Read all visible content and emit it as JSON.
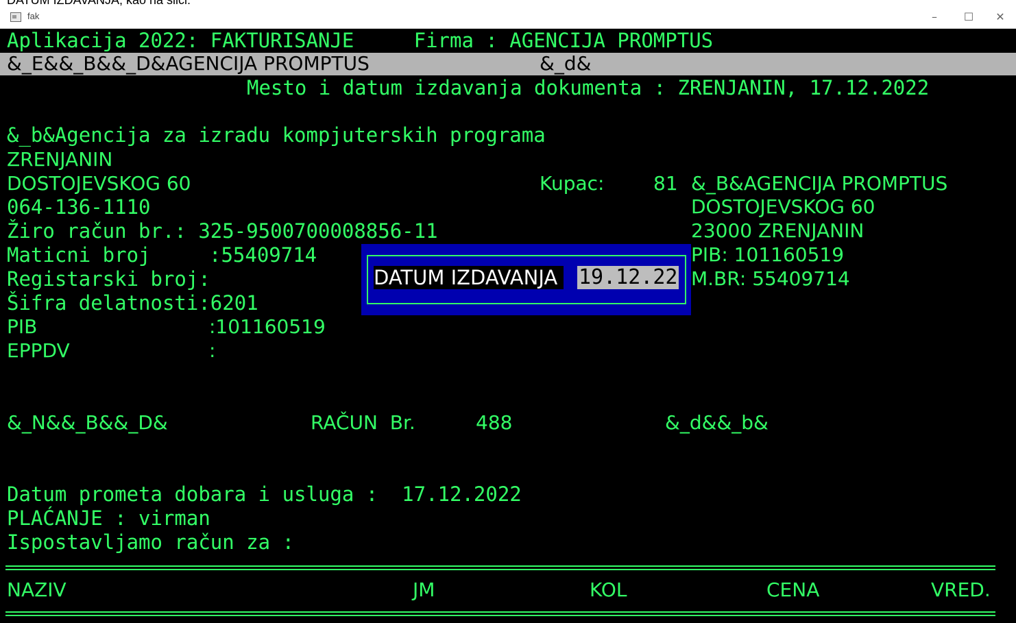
{
  "window": {
    "title": "fak",
    "caption_above": "DATUM IZDAVANJA, kao na slici:",
    "minimize": "–",
    "maximize": "☐",
    "close": "✕"
  },
  "header": {
    "app_line": "Aplikacija 2022: FAKTURISANJE     Firma : AGENCIJA PROMPTUS",
    "bar_left": "&_E&&_B&&_D&AGENCIJA PROMPTUS",
    "bar_right": "&_d&",
    "place_date": "Mesto i datum izdavanja dokumenta : ZRENJANIN, 17.12.2022"
  },
  "issuer": {
    "line1": "&_b&Agencija za izradu kompjuterskih programa",
    "city": "ZRENJANIN",
    "address": "DOSTOJEVSKOG 60",
    "phone": "064-136-1110",
    "account": "Žiro račun br.: 325-9500700008856-11",
    "maticni_label": "Maticni broj    ",
    "maticni_value": ":55409714",
    "registarski": "Registarski broj:",
    "sifra": "Šifra delatnosti:6201",
    "pib_label": "PIB",
    "pib_value": ":101160519",
    "eppdv_label": "EPPDV",
    "eppdv_value": ":"
  },
  "buyer": {
    "label": "Kupac:",
    "id": "81",
    "name": "&_B&AGENCIJA PROMPTUS",
    "address": "DOSTOJEVSKOG 60",
    "city": "23000 ZRENJANIN",
    "pib": "PIB: 101160519",
    "mbr": "M.BR: 55409714"
  },
  "dialog": {
    "label": "DATUM IZDAVANJA ",
    "value": "19.12.22"
  },
  "invoice": {
    "codes_left": "&_N&&_B&&_D&",
    "title": "RAČUN  Br.",
    "number": "488",
    "codes_right": "&_d&&_b&",
    "datum_prometa": "Datum prometa dobara i usluga :  17.12.2022",
    "placanje": "PLAĆANJE : virman",
    "ispostavljamo": "Ispostavljamo račun za :"
  },
  "table": {
    "col_naziv": "NAZIV",
    "col_jm": "JM",
    "col_kol": "KOL",
    "col_cena": "CENA",
    "col_vred": "VRED."
  },
  "colors": {
    "console_bg": "#000000",
    "console_fg": "#33ff66",
    "bar_bg": "#b4b4b4",
    "dialog_bg": "#0000b0"
  }
}
